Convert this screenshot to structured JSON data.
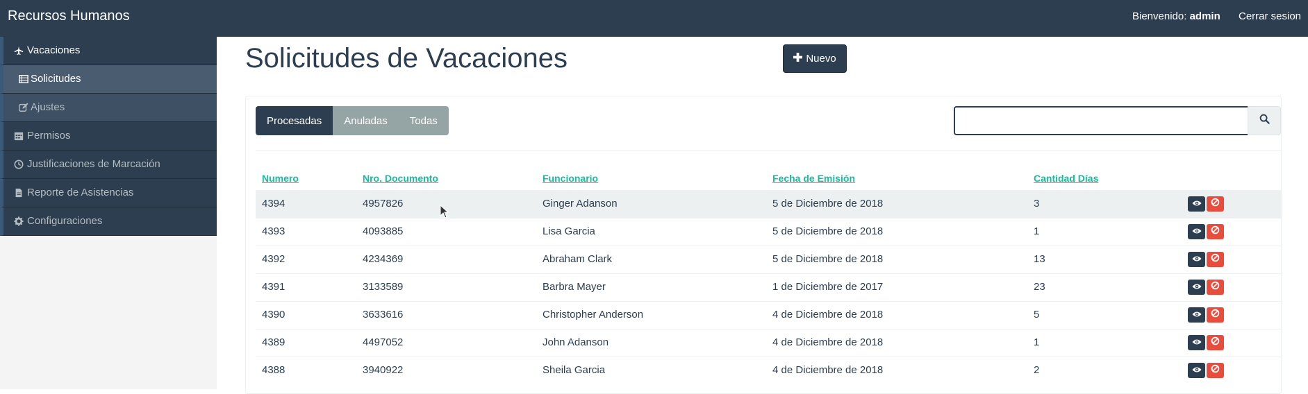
{
  "navbar": {
    "brand": "Recursos Humanos",
    "welcome_prefix": "Bienvenido:",
    "user": "admin",
    "logout": "Cerrar sesion"
  },
  "sidebar": {
    "items": [
      {
        "label": "Vacaciones",
        "icon": "plane-icon"
      },
      {
        "label": "Solicitudes",
        "icon": "list-icon"
      },
      {
        "label": "Ajustes",
        "icon": "edit-icon"
      },
      {
        "label": "Permisos",
        "icon": "calendar-icon"
      },
      {
        "label": "Justificaciones de Marcación",
        "icon": "clock-icon"
      },
      {
        "label": "Reporte de Asistencias",
        "icon": "file-icon"
      },
      {
        "label": "Configuraciones",
        "icon": "gear-icon"
      }
    ]
  },
  "main": {
    "title": "Solicitudes de Vacaciones",
    "new_button": "Nuevo",
    "tabs": [
      "Procesadas",
      "Anuladas",
      "Todas"
    ],
    "search": {
      "value": "",
      "placeholder": ""
    }
  },
  "table": {
    "headers": [
      "Numero",
      "Nro. Documento",
      "Funcionario",
      "Fecha de Emisión",
      "Cantidad Días"
    ],
    "rows": [
      {
        "numero": "4394",
        "documento": "4957826",
        "funcionario": "Ginger Adanson",
        "fecha": "5 de Diciembre de 2018",
        "dias": "3"
      },
      {
        "numero": "4393",
        "documento": "4093885",
        "funcionario": "Lisa Garcia",
        "fecha": "5 de Diciembre de 2018",
        "dias": "1"
      },
      {
        "numero": "4392",
        "documento": "4234369",
        "funcionario": "Abraham Clark",
        "fecha": "5 de Diciembre de 2018",
        "dias": "13"
      },
      {
        "numero": "4391",
        "documento": "3133589",
        "funcionario": "Barbra Mayer",
        "fecha": "1 de Diciembre de 2017",
        "dias": "23"
      },
      {
        "numero": "4390",
        "documento": "3633616",
        "funcionario": "Christopher Anderson",
        "fecha": "4 de Diciembre de 2018",
        "dias": "5"
      },
      {
        "numero": "4389",
        "documento": "4497052",
        "funcionario": "John Adanson",
        "fecha": "4 de Diciembre de 2018",
        "dias": "1"
      },
      {
        "numero": "4388",
        "documento": "3940922",
        "funcionario": "Sheila Garcia",
        "fecha": "4 de Diciembre de 2018",
        "dias": "2"
      }
    ]
  },
  "colors": {
    "primary": "#2c3e50",
    "link": "#18bc9c",
    "danger": "#e74c3c",
    "tab_inactive": "#95a5a6"
  }
}
